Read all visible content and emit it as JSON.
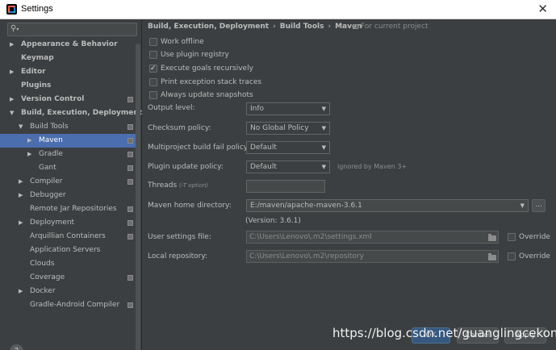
{
  "window": {
    "title": "Settings"
  },
  "breadcrumb": [
    "Build, Execution, Deployment",
    "Build Tools",
    "Maven"
  ],
  "breadcrumb_note": "For current project",
  "tree": [
    {
      "label": "Appearance & Behavior",
      "bold": true,
      "arrow": "▶",
      "proj": false,
      "selected": false,
      "indent": 0
    },
    {
      "label": "Keymap",
      "bold": true,
      "arrow": "",
      "proj": false,
      "selected": false,
      "indent": 0
    },
    {
      "label": "Editor",
      "bold": true,
      "arrow": "▶",
      "proj": false,
      "selected": false,
      "indent": 0
    },
    {
      "label": "Plugins",
      "bold": true,
      "arrow": "",
      "proj": false,
      "selected": false,
      "indent": 0
    },
    {
      "label": "Version Control",
      "bold": true,
      "arrow": "▶",
      "proj": true,
      "selected": false,
      "indent": 0
    },
    {
      "label": "Build, Execution, Deployment",
      "bold": true,
      "arrow": "▼",
      "proj": false,
      "selected": false,
      "indent": 0
    },
    {
      "label": "Build Tools",
      "bold": false,
      "arrow": "▼",
      "proj": true,
      "selected": false,
      "indent": 1
    },
    {
      "label": "Maven",
      "bold": false,
      "arrow": "▶",
      "proj": true,
      "selected": true,
      "indent": 2
    },
    {
      "label": "Gradle",
      "bold": false,
      "arrow": "▶",
      "proj": true,
      "selected": false,
      "indent": 2
    },
    {
      "label": "Gant",
      "bold": false,
      "arrow": "",
      "proj": true,
      "selected": false,
      "indent": 2
    },
    {
      "label": "Compiler",
      "bold": false,
      "arrow": "▶",
      "proj": true,
      "selected": false,
      "indent": 1
    },
    {
      "label": "Debugger",
      "bold": false,
      "arrow": "▶",
      "proj": false,
      "selected": false,
      "indent": 1
    },
    {
      "label": "Remote Jar Repositories",
      "bold": false,
      "arrow": "",
      "proj": true,
      "selected": false,
      "indent": 1
    },
    {
      "label": "Deployment",
      "bold": false,
      "arrow": "▶",
      "proj": true,
      "selected": false,
      "indent": 1
    },
    {
      "label": "Arquillian Containers",
      "bold": false,
      "arrow": "",
      "proj": true,
      "selected": false,
      "indent": 1
    },
    {
      "label": "Application Servers",
      "bold": false,
      "arrow": "",
      "proj": false,
      "selected": false,
      "indent": 1
    },
    {
      "label": "Clouds",
      "bold": false,
      "arrow": "",
      "proj": false,
      "selected": false,
      "indent": 1
    },
    {
      "label": "Coverage",
      "bold": false,
      "arrow": "",
      "proj": true,
      "selected": false,
      "indent": 1
    },
    {
      "label": "Docker",
      "bold": false,
      "arrow": "▶",
      "proj": false,
      "selected": false,
      "indent": 1
    },
    {
      "label": "Gradle-Android Compiler",
      "bold": false,
      "arrow": "",
      "proj": true,
      "selected": false,
      "indent": 1
    }
  ],
  "checkboxes": [
    {
      "label": "Work offline",
      "checked": false
    },
    {
      "label": "Use plugin registry",
      "checked": false
    },
    {
      "label": "Execute goals recursively",
      "checked": true
    },
    {
      "label": "Print exception stack traces",
      "checked": false
    },
    {
      "label": "Always update snapshots",
      "checked": false
    }
  ],
  "fields": {
    "output_level": {
      "label": "Output level:",
      "value": "Info"
    },
    "checksum_policy": {
      "label": "Checksum policy:",
      "value": "No Global Policy"
    },
    "multiproject_fail": {
      "label": "Multiproject build fail policy:",
      "value": "Default"
    },
    "plugin_update": {
      "label": "Plugin update policy:",
      "value": "Default",
      "hint": "ignored by Maven 3+"
    },
    "threads": {
      "label": "Threads",
      "hint": "(-T option)",
      "value": ""
    },
    "maven_home": {
      "label": "Maven home directory:",
      "value": "E:/maven/apache-maven-3.6.1",
      "version": "(Version: 3.6.1)"
    },
    "user_settings": {
      "label": "User settings file:",
      "value": "C:\\Users\\Lenovo\\.m2\\settings.xml",
      "override": "Override"
    },
    "local_repo": {
      "label": "Local repository:",
      "value": "C:\\Users\\Lenovo\\.m2\\repository",
      "override": "Override"
    }
  },
  "buttons": {
    "ok": "OK",
    "cancel": "Cancel",
    "apply": "Apply"
  },
  "help": "?",
  "watermark": "https://blog.csdn.net/guanglingcekong"
}
